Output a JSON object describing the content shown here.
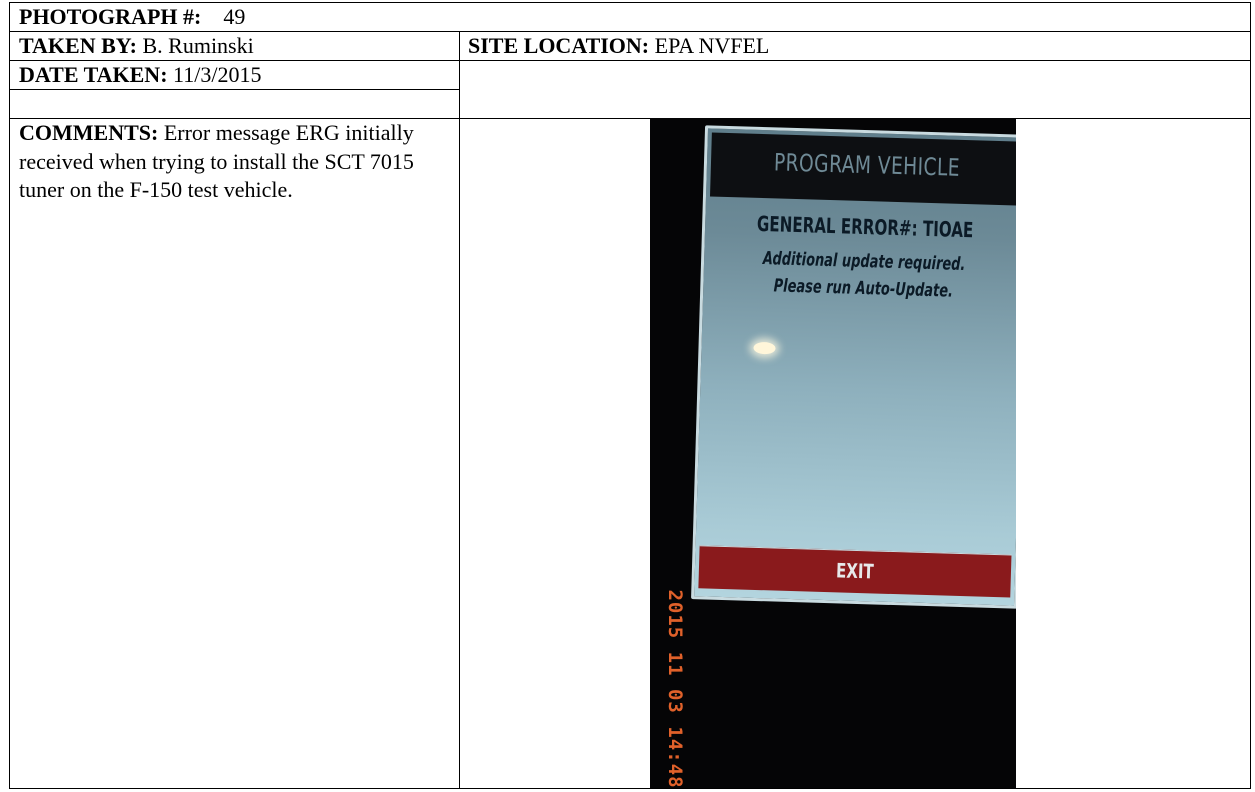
{
  "photograph": {
    "label": "PHOTOGRAPH #:",
    "value": "49"
  },
  "taken_by": {
    "label": "TAKEN BY:",
    "value": "B. Ruminski"
  },
  "site_location": {
    "label": "SITE LOCATION:",
    "value": "EPA NVFEL"
  },
  "date_taken": {
    "label": "DATE TAKEN:",
    "value": "11/3/2015"
  },
  "comments": {
    "label": "COMMENTS:",
    "value": "Error message ERG initially received when trying to install the SCT 7015 tuner on the F-150 test vehicle."
  },
  "photo": {
    "screen_title": "PROGRAM VEHICLE",
    "error_line": "GENERAL ERROR#: TIOAE",
    "message_line_1": "Additional update required.",
    "message_line_2": "Please run Auto-Update.",
    "exit_label": "EXIT",
    "timestamp": "2015 11 03 14:48",
    "colors": {
      "screen_top": "#5f7e8b",
      "screen_bottom": "#b3d4de",
      "exit_bar": "#8a1a1c",
      "timestamp": "#e0612a"
    }
  }
}
